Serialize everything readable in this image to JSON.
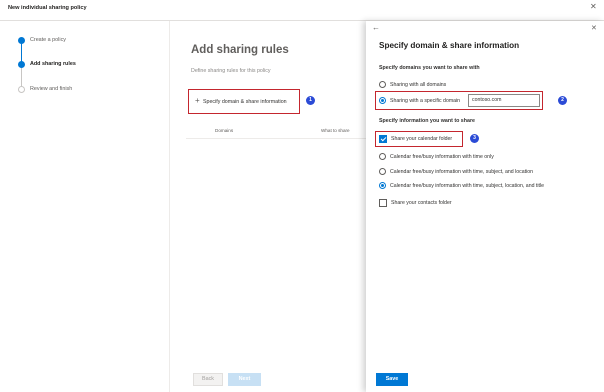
{
  "wizard": {
    "title": "New individual sharing policy",
    "close_glyph": "✕"
  },
  "steps": [
    {
      "label": "Create a policy",
      "state": "complete"
    },
    {
      "label": "Add sharing rules",
      "state": "current"
    },
    {
      "label": "Review and finish",
      "state": "pending"
    }
  ],
  "main": {
    "title": "Add sharing rules",
    "subtitle": "Define sharing rules for this policy",
    "add_button": {
      "icon": "plus-icon",
      "glyph": "+",
      "label": "Specify domain & share information"
    },
    "columns": [
      "Domains",
      "What to share"
    ],
    "badge": "1"
  },
  "footer": {
    "back_label": "Back",
    "next_label": "Next"
  },
  "panel": {
    "back_glyph": "←",
    "close_glyph": "✕",
    "title": "Specify domain & share information",
    "domains_heading": "Specify domains you want to share with",
    "domain_options": [
      {
        "label": "Sharing with all domains",
        "selected": false
      },
      {
        "label": "Sharing with a specific domain",
        "selected": true
      }
    ],
    "domain_value": "contoso.com",
    "domain_badge": "2",
    "info_heading": "Specify information you want to share",
    "calendar_checkbox": {
      "label": "Share your calendar folder",
      "checked": true
    },
    "calendar_badge": "3",
    "calendar_options": [
      {
        "label": "Calendar free/busy information with time only",
        "selected": false
      },
      {
        "label": "Calendar free/busy information with time, subject, and location",
        "selected": false
      },
      {
        "label": "Calendar free/busy information with time, subject, location, and title",
        "selected": true
      }
    ],
    "contacts_checkbox": {
      "label": "Share your contacts folder",
      "checked": false
    },
    "save_label": "Save"
  },
  "colors": {
    "accent": "#0078d4",
    "highlight_box": "#c4262e",
    "badge": "#2b4bd6"
  }
}
